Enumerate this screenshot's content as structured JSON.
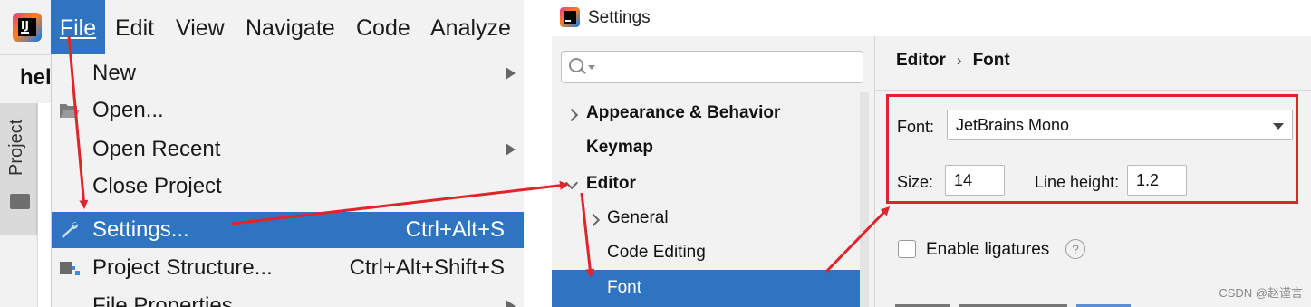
{
  "ide": {
    "menubar": {
      "items": [
        {
          "label": "File"
        },
        {
          "label": "Edit"
        },
        {
          "label": "View"
        },
        {
          "label": "Navigate"
        },
        {
          "label": "Code"
        },
        {
          "label": "Analyze"
        }
      ],
      "active": "File"
    },
    "project_name": "hel",
    "tool_window": "Project",
    "file_menu": {
      "items": [
        {
          "label": "New",
          "submenu": true
        },
        {
          "label": "Open...",
          "icon": "folder-open-icon"
        },
        {
          "label": "Open Recent",
          "submenu": true
        },
        {
          "label": "Close Project"
        },
        {
          "label": "Settings...",
          "shortcut": "Ctrl+Alt+S",
          "icon": "wrench-icon",
          "selected": true
        },
        {
          "label": "Project Structure...",
          "shortcut": "Ctrl+Alt+Shift+S",
          "icon": "project-structure-icon"
        },
        {
          "label": "File Properties",
          "submenu": true
        }
      ]
    }
  },
  "settings": {
    "title": "Settings",
    "search": {
      "value": "",
      "placeholder": ""
    },
    "tree": [
      {
        "label": "Appearance & Behavior",
        "expanded": false
      },
      {
        "label": "Keymap"
      },
      {
        "label": "Editor",
        "expanded": true
      },
      {
        "label": "General",
        "expanded": false
      },
      {
        "label": "Code Editing"
      },
      {
        "label": "Font",
        "selected": true
      }
    ],
    "breadcrumb": [
      "Editor",
      "Font"
    ],
    "font": {
      "font_label": "Font:",
      "font_value": "JetBrains Mono",
      "size_label": "Size:",
      "size_value": "14",
      "line_height_label": "Line height:",
      "line_height_value": "1.2"
    },
    "ligatures_label": "Enable ligatures",
    "ligatures_checked": false,
    "help_glyph": "?"
  },
  "watermark": "CSDN @赵谨言",
  "colors": {
    "selection": "#2f74c0",
    "annotation_arrow": "#e0242c"
  }
}
